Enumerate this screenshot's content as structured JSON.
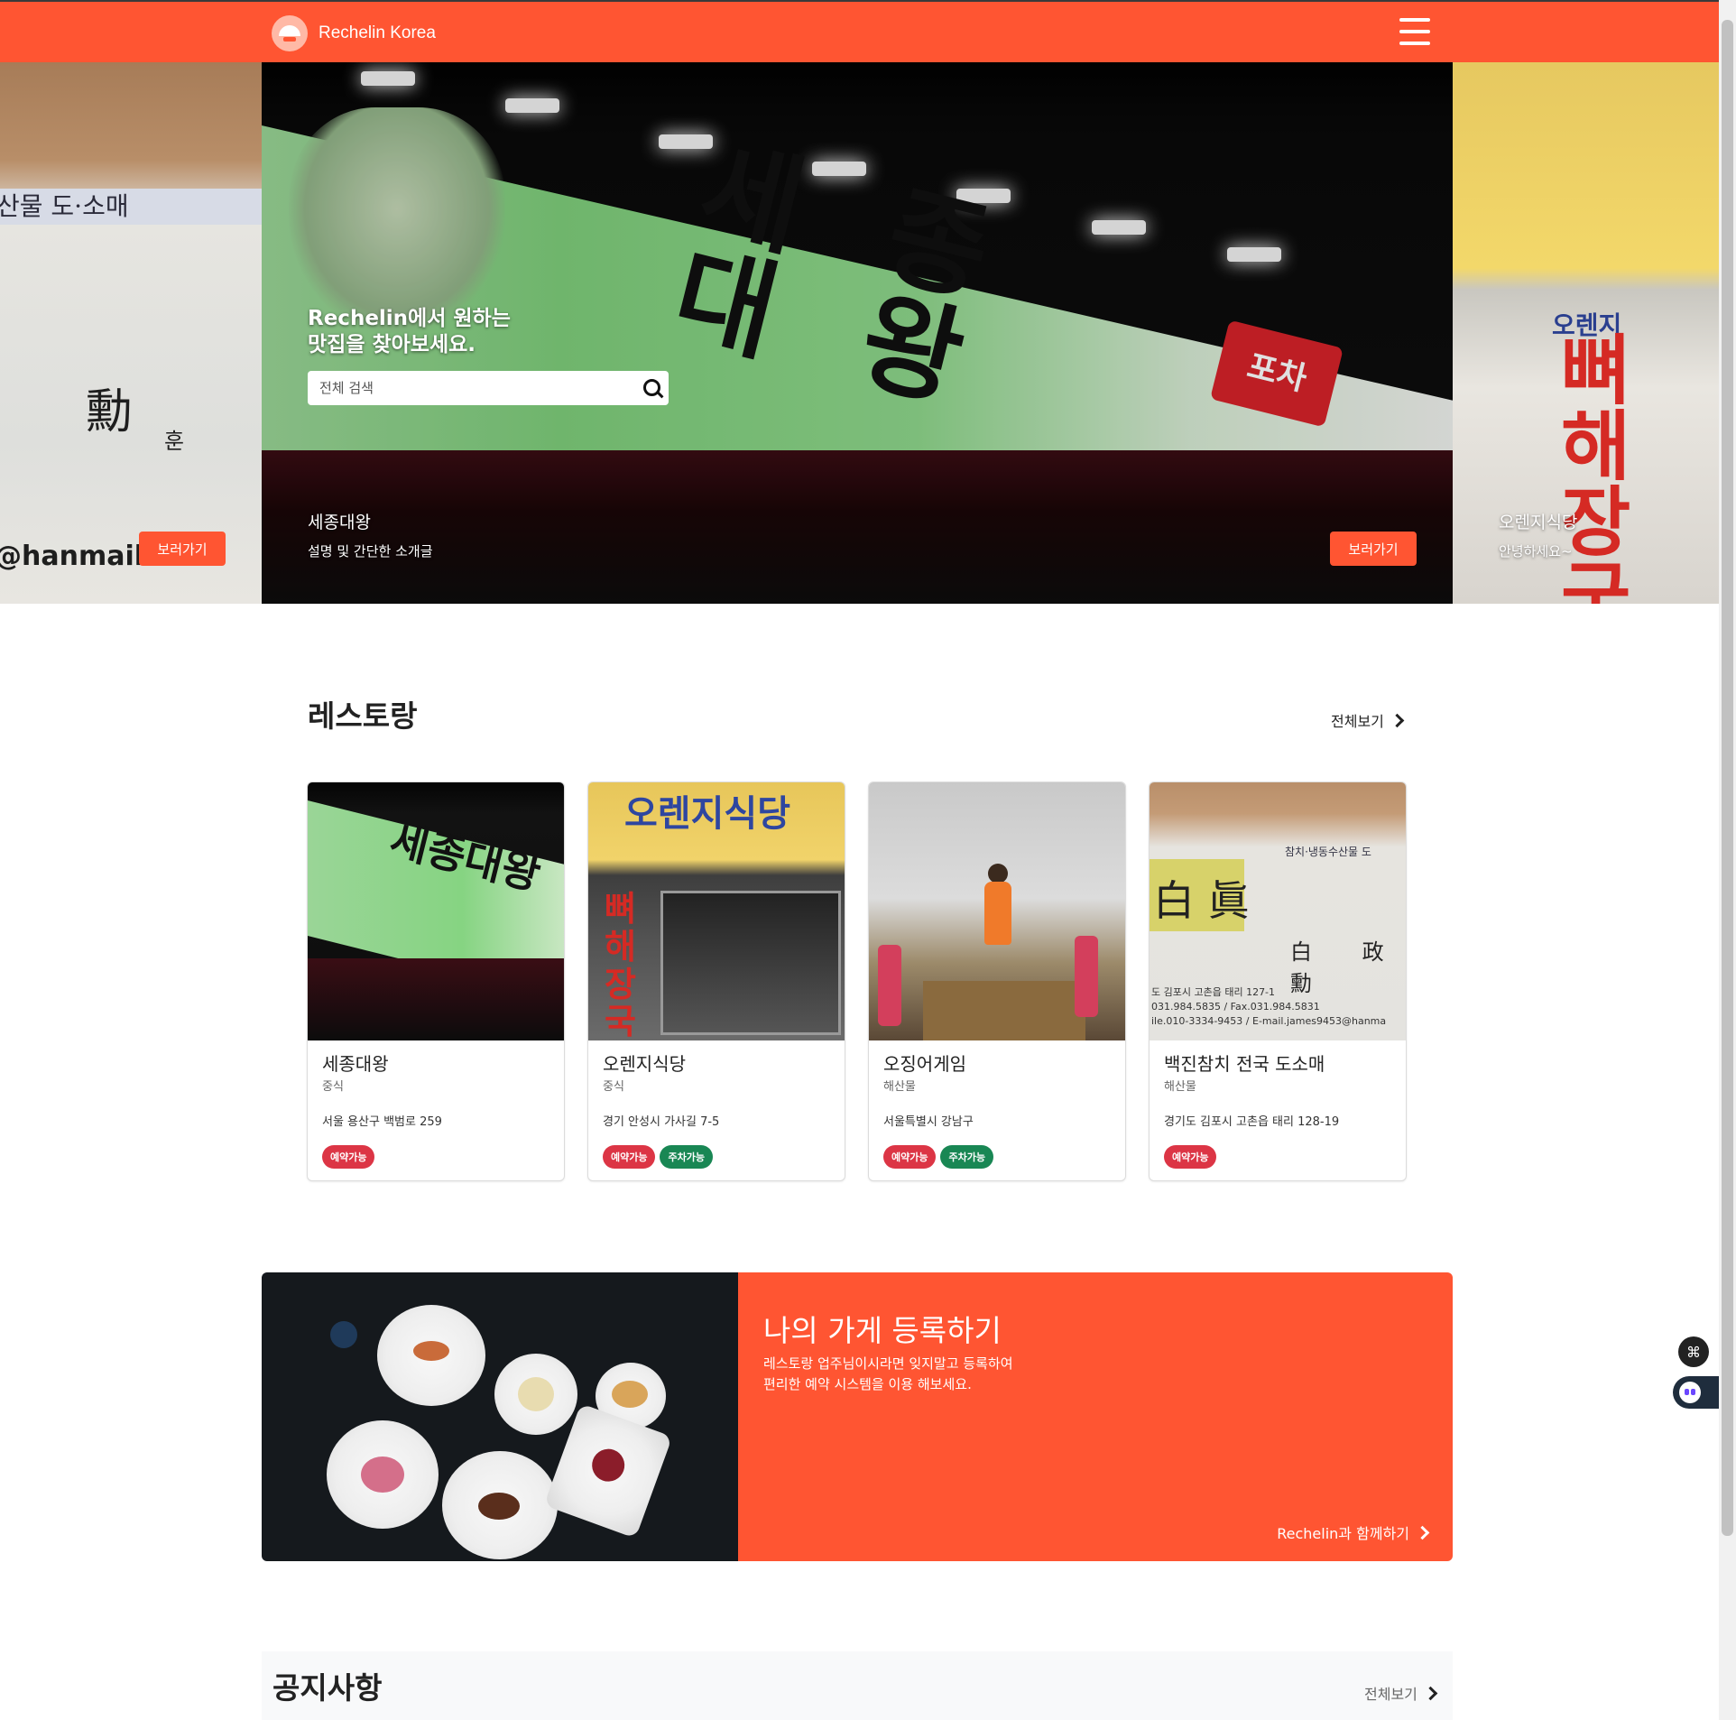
{
  "app": {
    "brand": "Rechelin Korea",
    "menu_icon": "hamburger-icon"
  },
  "colors": {
    "accent": "#ff5532",
    "badge_reserve": "#dc3545",
    "badge_parking": "#198754"
  },
  "hero": {
    "heading_line1": "Rechelin에서 원하는",
    "heading_line2": "맛집을 찾아보세요.",
    "search_placeholder": "전체 검색",
    "slides": [
      {
        "title": "",
        "subtitle": "",
        "button": "보러가기"
      },
      {
        "title": "세종대왕",
        "subtitle": "설명 및 간단한 소개글",
        "button": "보러가기"
      },
      {
        "title": "오렌지식당",
        "subtitle": "안녕하세요~"
      }
    ],
    "left_slide_art": {
      "banner": "산물 도·소매",
      "hanja": "勳",
      "hanja_reading": "훈",
      "email": "@hanmail.net"
    },
    "main_slide_art": {
      "sign_line1": "세 종",
      "sign_line2": "대 왕",
      "stamp": "포차"
    },
    "right_slide_art": {
      "top": "오렌지",
      "vertical": "뼈해장국"
    }
  },
  "restaurants": {
    "title": "레스토랑",
    "view_all": "전체보기",
    "items": [
      {
        "name": "세종대왕",
        "category": "중식",
        "address": "서울 용산구 백범로 259",
        "badges": [
          "예약가능"
        ],
        "art": {
          "sign": "세종대왕"
        }
      },
      {
        "name": "오렌지식당",
        "category": "중식",
        "address": "경기 안성시 가사길 7-5",
        "badges": [
          "예약가능",
          "주차가능"
        ],
        "art": {
          "sign": "오렌지식당",
          "vertical": "뼈해장국"
        }
      },
      {
        "name": "오징어게임",
        "category": "해산물",
        "address": "서울특별시 강남구",
        "badges": [
          "예약가능",
          "주차가능"
        ]
      },
      {
        "name": "백진참치 전국 도소매",
        "category": "해산물",
        "address": "경기도 김포시 고촌읍 태리 128-19",
        "badges": [
          "예약가능"
        ],
        "art": {
          "sign": "참치·냉동수산물 도",
          "big": "白 眞",
          "name_chars": "白 政 勳",
          "line1": "도 김포시 고촌읍 태리 127-1",
          "line2": "031.984.5835 / Fax.031.984.5831",
          "line3": "ile.010-3334-9453 / E-mail.james9453@hanma"
        }
      }
    ]
  },
  "register": {
    "title": "나의 가게 등록하기",
    "desc_line1": "레스토랑 업주님이시라면 잊지말고 등록하여",
    "desc_line2": "편리한 예약 시스템을 이용 해보세요.",
    "link": "Rechelin과 함께하기"
  },
  "notice": {
    "title": "공지사항",
    "view_all": "전체보기"
  },
  "widgets": {
    "fab1_icon": "command-icon",
    "fab2_icon": "chatbot-icon"
  }
}
